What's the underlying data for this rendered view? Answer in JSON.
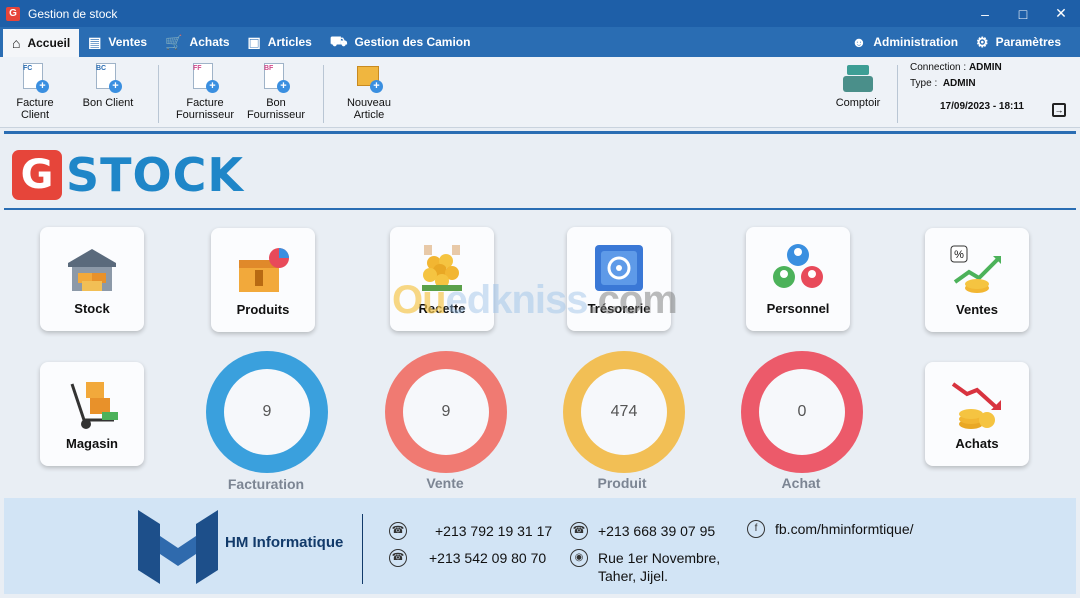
{
  "window": {
    "title": "Gestion de stock",
    "app_icon_letter": "G"
  },
  "menu": {
    "items": [
      {
        "label": "Accueil",
        "icon": "home-icon"
      },
      {
        "label": "Ventes",
        "icon": "register-icon"
      },
      {
        "label": "Achats",
        "icon": "cart-icon"
      },
      {
        "label": "Articles",
        "icon": "box-icon"
      },
      {
        "label": "Gestion des Camion",
        "icon": "truck-icon"
      }
    ],
    "right": [
      {
        "label": "Administration",
        "icon": "user-icon"
      },
      {
        "label": "Paramètres",
        "icon": "gear-icon"
      }
    ]
  },
  "toolbar": {
    "buttons": [
      {
        "tag": "FC",
        "line1": "Facture",
        "line2": "Client"
      },
      {
        "tag": "BC",
        "line1": "Bon Client",
        "line2": ""
      },
      {
        "tag": "FF",
        "line1": "Facture",
        "line2": "Fournisseur"
      },
      {
        "tag": "BF",
        "line1": "Bon",
        "line2": "Fournisseur"
      },
      {
        "tag": "",
        "line1": "Nouveau",
        "line2": "Article"
      }
    ],
    "comptoir": "Comptoir",
    "connection_label": "Connection :",
    "connection_value": "ADMIN",
    "type_label": "Type :",
    "type_value": "ADMIN",
    "datetime": "17/09/2023 - 18:11"
  },
  "logo": {
    "letter": "G",
    "text": "STOCK"
  },
  "tiles": [
    {
      "label": "Stock",
      "icon": "warehouse-icon"
    },
    {
      "label": "Produits",
      "icon": "product-box-icon"
    },
    {
      "label": "Recette",
      "icon": "coins-hands-icon"
    },
    {
      "label": "Trésorerie",
      "icon": "safe-icon"
    },
    {
      "label": "Personnel",
      "icon": "team-icon"
    },
    {
      "label": "Ventes",
      "icon": "sales-growth-icon"
    },
    {
      "label": "Magasin",
      "icon": "hand-truck-icon"
    },
    {
      "label": "Achats",
      "icon": "purchase-decline-icon"
    }
  ],
  "stats": [
    {
      "label": "Facturation",
      "value": "9",
      "color": "#3aa0dd"
    },
    {
      "label": "Vente",
      "value": "9",
      "color": "#f07a72"
    },
    {
      "label": "Produit",
      "value": "474",
      "color": "#f2bf55"
    },
    {
      "label": "Achat",
      "value": "0",
      "color": "#ec5a6a"
    }
  ],
  "watermark": {
    "part1": "Ou",
    "part2": "edkniss",
    "part3": ".com"
  },
  "footer": {
    "company": "HM Informatique",
    "phone1": "+213 792 19 31 17",
    "phone2": "+213 542 09 80 70",
    "phone3": "+213 668 39 07 95",
    "address_line1": "Rue 1er Novembre,",
    "address_line2": "Taher, Jijel.",
    "facebook": "fb.com/hminformtique/"
  },
  "colors": {
    "titlebar": "#1e5fa8",
    "menubar": "#2a6db3",
    "logo_red": "#e6453a",
    "logo_blue": "#1f86c8",
    "footer_bg": "#d2e4f5"
  }
}
